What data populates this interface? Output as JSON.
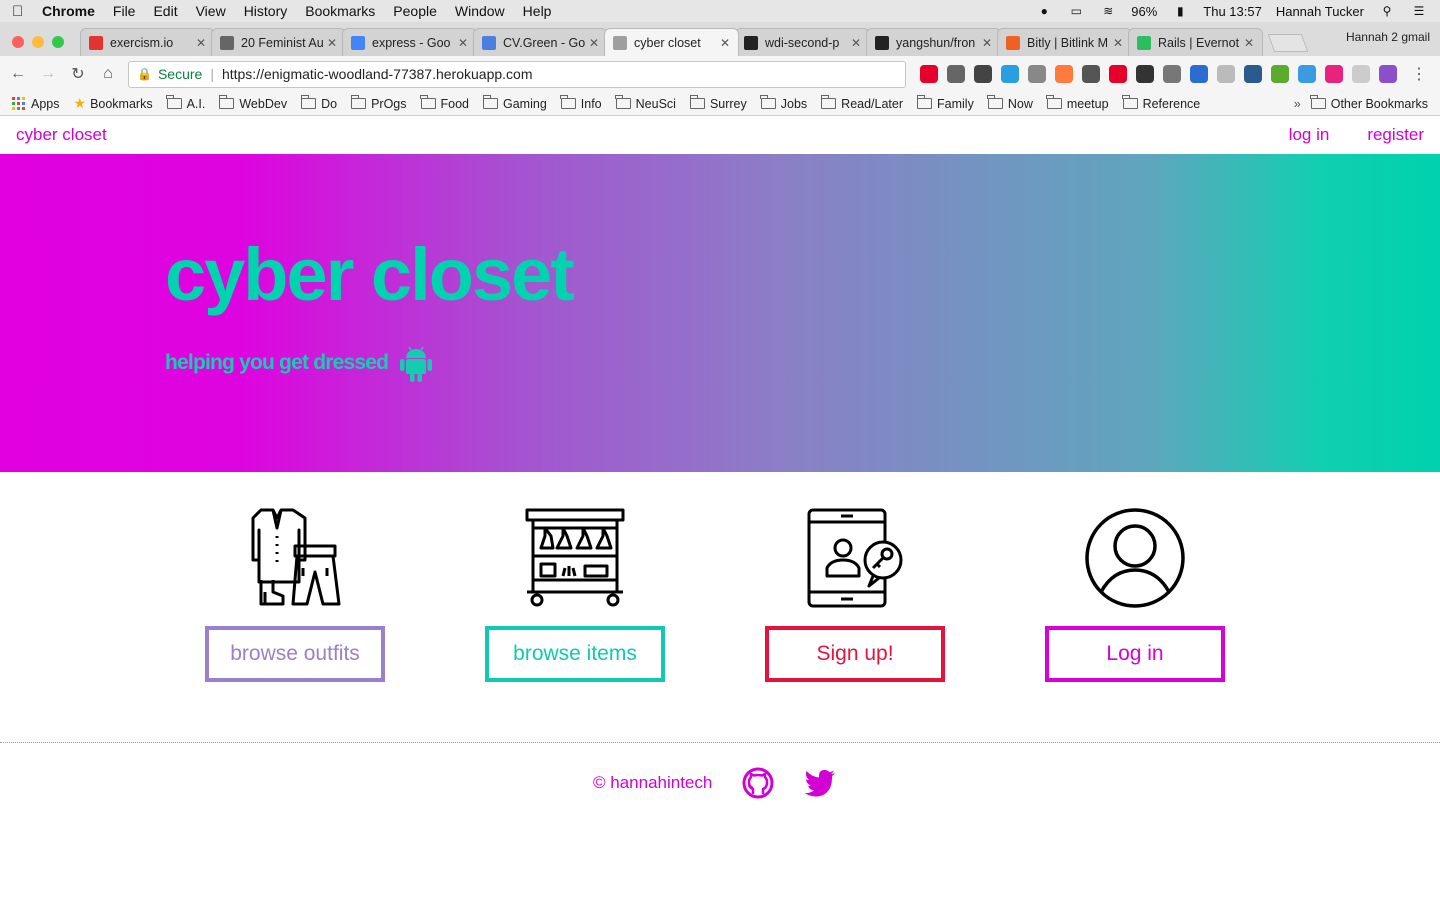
{
  "menubar": {
    "app": "Chrome",
    "menus": [
      "File",
      "Edit",
      "View",
      "History",
      "Bookmarks",
      "People",
      "Window",
      "Help"
    ],
    "battery": "96%",
    "clock": "Thu 13:57",
    "user": "Hannah Tucker"
  },
  "tabs": [
    {
      "title": "exercism.io",
      "favicon_color": "#e3342f"
    },
    {
      "title": "20 Feminist Au",
      "favicon_color": "#666666"
    },
    {
      "title": "express - Goo",
      "favicon_color": "#4285f4"
    },
    {
      "title": "CV.Green - Go",
      "favicon_color": "#4a7fe0"
    },
    {
      "title": "cyber closet",
      "favicon_color": "#9e9e9e"
    },
    {
      "title": "wdi-second-p",
      "favicon_color": "#222222"
    },
    {
      "title": "yangshun/fron",
      "favicon_color": "#222222"
    },
    {
      "title": "Bitly | Bitlink M",
      "favicon_color": "#ee6123"
    },
    {
      "title": "Rails | Evernot",
      "favicon_color": "#2dbe60"
    }
  ],
  "active_tab_index": 4,
  "profile_name": "Hannah 2 gmail",
  "toolbar": {
    "secure_label": "Secure",
    "url": "https://enigmatic-woodland-77387.herokuapp.com"
  },
  "extensions": [
    {
      "name": "opera-vpn-icon",
      "color": "#e4002b"
    },
    {
      "name": "lightbulb-icon",
      "color": "#666666"
    },
    {
      "name": "evernote-icon",
      "color": "#444444"
    },
    {
      "name": "trello-icon",
      "color": "#2a9ee0"
    },
    {
      "name": "recycle-icon",
      "color": "#888888"
    },
    {
      "name": "plus-icon",
      "color": "#ff7a3d"
    },
    {
      "name": "pocket-icon",
      "color": "#555555"
    },
    {
      "name": "opera-icon",
      "color": "#e4002b"
    },
    {
      "name": "crown-icon",
      "color": "#333333"
    },
    {
      "name": "star-icon",
      "color": "#777777"
    },
    {
      "name": "off-icon",
      "color": "#2a6cd1"
    },
    {
      "name": "feather-icon",
      "color": "#bbbbbb"
    },
    {
      "name": "infinity-icon",
      "color": "#2a5b8c"
    },
    {
      "name": "download-icon",
      "color": "#5aab2e"
    },
    {
      "name": "calendar-icon",
      "color": "#3c9be0"
    },
    {
      "name": "pink-circle-icon",
      "color": "#e8237b"
    },
    {
      "name": "circle-outline-icon",
      "color": "#cccccc"
    },
    {
      "name": "edit-icon",
      "color": "#8a4fc9"
    }
  ],
  "bookmarks": {
    "apps_label": "Apps",
    "bookmarks_label": "Bookmarks",
    "folders": [
      "A.I.",
      "WebDev",
      "Do",
      "PrOgs",
      "Food",
      "Gaming",
      "Info",
      "NeuSci",
      "Surrey",
      "Jobs",
      "Read/Later",
      "Family",
      "Now",
      "meetup",
      "Reference"
    ],
    "other_label": "Other Bookmarks"
  },
  "site": {
    "brand": "cyber closet",
    "nav_links": [
      "log in",
      "register"
    ],
    "hero_title": "cyber closet",
    "hero_subtitle": "helping you get dressed",
    "features": [
      {
        "label": "browse outfits",
        "color": "#9a80c8",
        "icon": "outfit-icon"
      },
      {
        "label": "browse items",
        "color": "#11c9b2",
        "icon": "clothing-rack-icon"
      },
      {
        "label": "Sign up!",
        "color": "#e3133d",
        "icon": "tablet-signup-icon"
      },
      {
        "label": "Log in",
        "color": "#d800d6",
        "icon": "user-profile-icon"
      }
    ],
    "footer_text": "© hannahintech",
    "accent": "#d200d4"
  }
}
